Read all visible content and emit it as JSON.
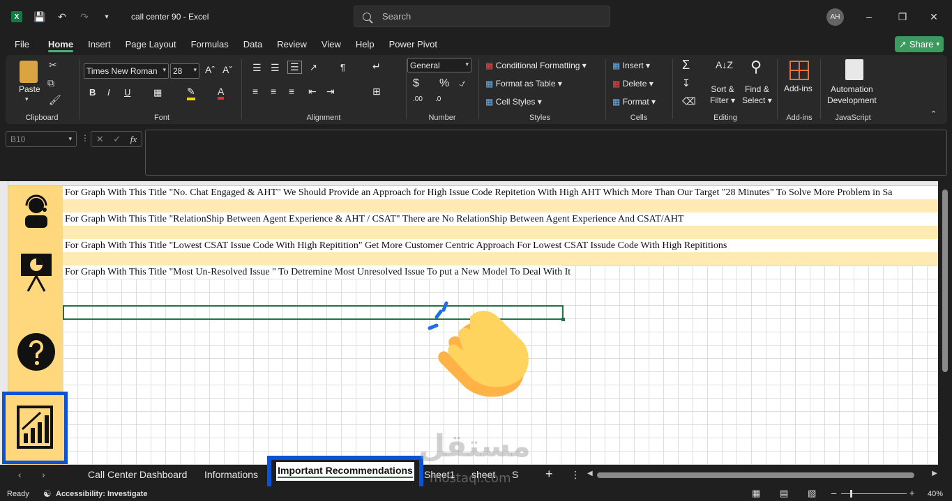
{
  "titlebar": {
    "doc_title": "call center 90 - Excel",
    "search_placeholder": "Search",
    "avatar_initials": "AH"
  },
  "menu": {
    "tabs": [
      "File",
      "Home",
      "Insert",
      "Page Layout",
      "Formulas",
      "Data",
      "Review",
      "View",
      "Help",
      "Power Pivot"
    ],
    "active": "Home",
    "share_label": "Share"
  },
  "ribbon": {
    "clipboard": {
      "label": "Clipboard",
      "paste": "Paste"
    },
    "font": {
      "label": "Font",
      "family": "Times New Roman",
      "size": "28"
    },
    "alignment": {
      "label": "Alignment"
    },
    "number": {
      "label": "Number",
      "format": "General"
    },
    "styles": {
      "label": "Styles",
      "conditional": "Conditional Formatting",
      "format_table": "Format as Table",
      "cell_styles": "Cell Styles"
    },
    "cells": {
      "label": "Cells",
      "insert": "Insert",
      "delete": "Delete",
      "format": "Format"
    },
    "editing": {
      "label": "Editing",
      "sort_filter_1": "Sort &",
      "sort_filter_2": "Filter",
      "find_select_1": "Find &",
      "find_select_2": "Select"
    },
    "addins": {
      "label": "Add-ins",
      "button": "Add-ins"
    },
    "javascript": {
      "label": "JavaScript",
      "button_1": "Automation",
      "button_2": "Development"
    }
  },
  "formula_bar": {
    "name_box": "B10",
    "fx": "fx"
  },
  "sheet": {
    "recommendations": [
      "For Graph With This Title \"No. Chat Engaged & AHT\"  We Should Provide an Approach for High Issue Code Repitetion With High AHT Which More Than Our Target \"28 Minutes\" To Solve More Problem in Sa",
      "For Graph With This Title \"RelationShip Between Agent Experience & AHT / CSAT\" There are No RelationShip Between Agent Experience And CSAT/AHT",
      "For Graph With This Title \"Lowest CSAT Issue Code With High Repitition\" Get More Customer Centric Approach For Lowest CSAT Issude Code With High Repititions",
      "For Graph With This Title \"Most Un-Resolved Issue \" To Detremine Most Unresolved Issue To put a New Model To Deal With It"
    ],
    "sidebar_icons": [
      "agent-icon",
      "presentation-chart-icon",
      "question-icon",
      "bar-chart-icon"
    ],
    "decoration": "clapping-hands-icon"
  },
  "sheet_tabs": {
    "tabs": [
      "Call Center Dashboard",
      "Informations",
      "Important Recommendations",
      "Sheet1",
      "sheet",
      "S"
    ],
    "active": "Important Recommendations"
  },
  "statusbar": {
    "ready": "Ready",
    "accessibility": "Accessibility: Investigate",
    "zoom": "40%"
  },
  "watermark": {
    "arabic": "مستقل",
    "latin": "mostaql.com"
  },
  "colors": {
    "accent_green": "#217346",
    "highlight_blue": "#0b53d6",
    "sidebar_yellow": "#ffd87d",
    "band_yellow": "#ffeab3"
  }
}
